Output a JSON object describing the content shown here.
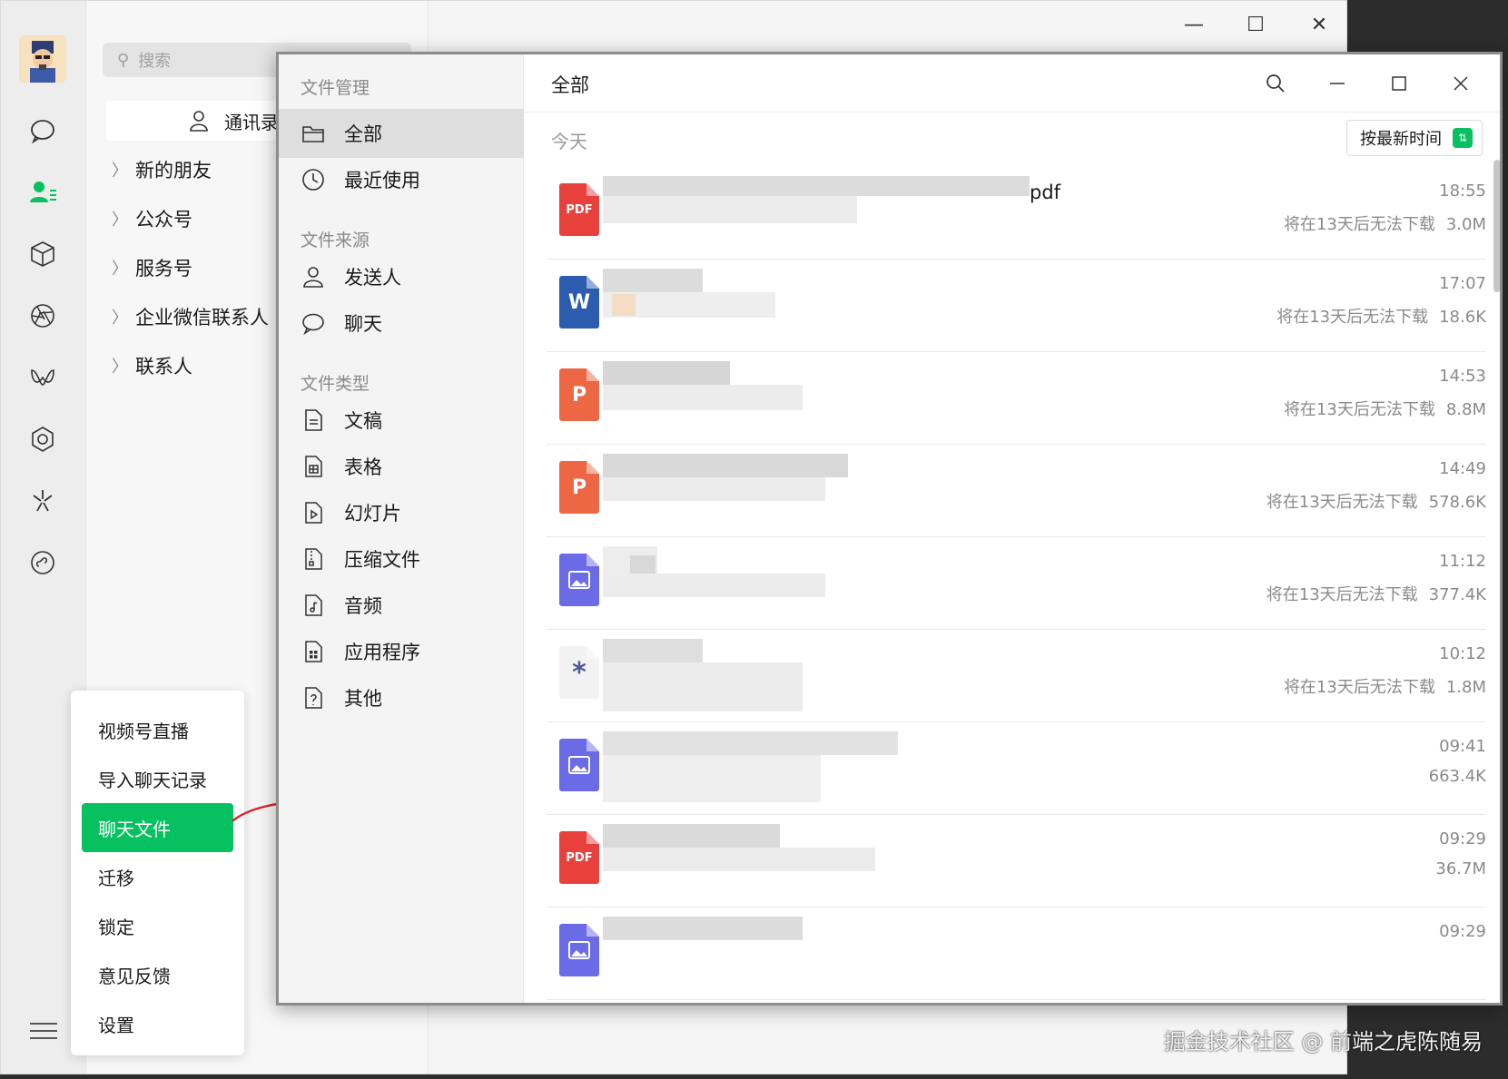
{
  "background_window": {
    "search_placeholder": "搜索",
    "contacts_button": "通讯录",
    "groups": [
      "新的朋友",
      "公众号",
      "服务号",
      "企业微信联系人",
      "联系人"
    ],
    "nav_icons": [
      "chat-icon",
      "contacts-icon",
      "box-icon",
      "aperture-icon",
      "channels-icon",
      "settings-gear-icon",
      "sparkle-icon",
      "mini-program-icon"
    ],
    "menu": [
      {
        "label": "视频号直播",
        "active": false
      },
      {
        "label": "导入聊天记录",
        "active": false
      },
      {
        "label": "聊天文件",
        "active": true
      },
      {
        "label": "迁移",
        "active": false
      },
      {
        "label": "锁定",
        "active": false
      },
      {
        "label": "意见反馈",
        "active": false
      },
      {
        "label": "设置",
        "active": false
      }
    ]
  },
  "file_manager": {
    "sidebar_title": "文件管理",
    "nav": [
      {
        "label": "全部",
        "icon": "folder-icon",
        "selected": true
      },
      {
        "label": "最近使用",
        "icon": "clock-icon",
        "selected": false
      }
    ],
    "source_title": "文件来源",
    "sources": [
      {
        "label": "发送人",
        "icon": "person-icon"
      },
      {
        "label": "聊天",
        "icon": "chat-bubble-icon"
      }
    ],
    "type_title": "文件类型",
    "types": [
      {
        "label": "文稿",
        "icon": "document-icon"
      },
      {
        "label": "表格",
        "icon": "spreadsheet-icon"
      },
      {
        "label": "幻灯片",
        "icon": "slides-icon"
      },
      {
        "label": "压缩文件",
        "icon": "zip-icon"
      },
      {
        "label": "音频",
        "icon": "audio-icon"
      },
      {
        "label": "应用程序",
        "icon": "app-icon"
      },
      {
        "label": "其他",
        "icon": "other-icon"
      }
    ],
    "header_title": "全部",
    "today_label": "今天",
    "sort_label": "按最新时间",
    "files": [
      {
        "type": "PDF",
        "name_visible": "pdf",
        "time": "18:55",
        "expire": "将在13天后无法下载",
        "size": "3.0M",
        "color": "#e8413c"
      },
      {
        "type": "W",
        "name_visible": "",
        "time": "17:07",
        "expire": "将在13天后无法下载",
        "size": "18.6K",
        "color": "#2b5cae"
      },
      {
        "type": "P",
        "name_visible": "",
        "time": "14:53",
        "expire": "将在13天后无法下载",
        "size": "8.8M",
        "color": "#ee6744"
      },
      {
        "type": "P",
        "name_visible": "",
        "time": "14:49",
        "expire": "将在13天后无法下载",
        "size": "578.6K",
        "color": "#ee6744"
      },
      {
        "type": "IMG",
        "name_visible": "",
        "time": "11:12",
        "expire": "将在13天后无法下载",
        "size": "377.4K",
        "color": "#6b6be8"
      },
      {
        "type": "*",
        "name_visible": "",
        "time": "10:12",
        "expire": "将在13天后无法下载",
        "size": "1.8M",
        "color": "#f2f2f2"
      },
      {
        "type": "IMG",
        "name_visible": "",
        "time": "09:41",
        "expire": "",
        "size": "663.4K",
        "color": "#6b6be8"
      },
      {
        "type": "PDF",
        "name_visible": "",
        "time": "09:29",
        "expire": "",
        "size": "36.7M",
        "color": "#e8413c"
      },
      {
        "type": "IMG",
        "name_visible": "",
        "time": "09:29",
        "expire": "",
        "size": "",
        "color": "#6b6be8"
      }
    ]
  },
  "watermark": "掘金技术社区 @ 前端之虎陈随易"
}
